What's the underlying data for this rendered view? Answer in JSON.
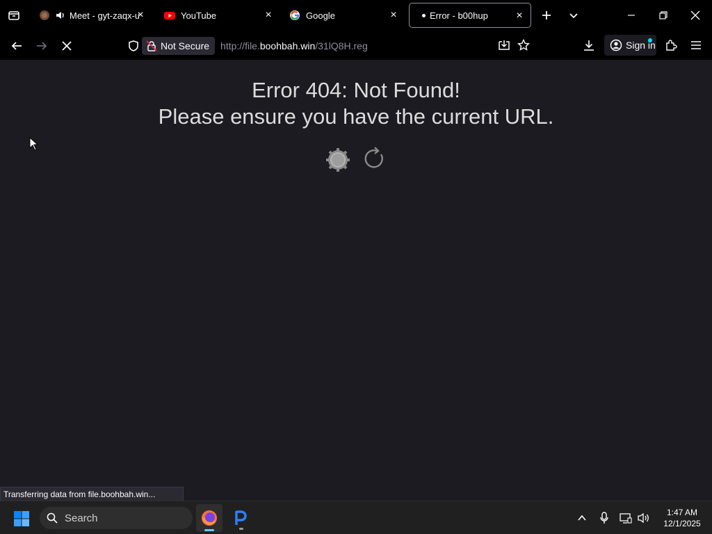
{
  "browser": {
    "tabs": [
      {
        "title": "Meet - gyt-zaqx-ufr",
        "audio": true
      },
      {
        "title": "YouTube"
      },
      {
        "title": "Google"
      },
      {
        "title": "Error - b00hup",
        "active": true
      }
    ],
    "nav": {
      "security_label": "Not Secure",
      "url_prefix": "http://file.",
      "url_host": "boohbah.win",
      "url_path": "/31lQ8H.reg",
      "signin_label": "Sign in"
    },
    "status_text": "Transferring data from file.boohbah.win..."
  },
  "page": {
    "error_title": "Error 404: Not Found!",
    "error_subtitle": "Please ensure you have the current URL."
  },
  "taskbar": {
    "search_label": "Search",
    "time": "1:47 AM",
    "date": "12/1/2025"
  },
  "colors": {
    "chrome_bg": "#000000",
    "page_bg": "#1c1b22",
    "text_primary": "#fbfbfe",
    "text_muted": "#8f8f9d",
    "error_text": "#dcdcdc",
    "youtube_red": "#ff0000",
    "firefox_orange": "#ff7139",
    "taskbar_bg": "#202020"
  }
}
